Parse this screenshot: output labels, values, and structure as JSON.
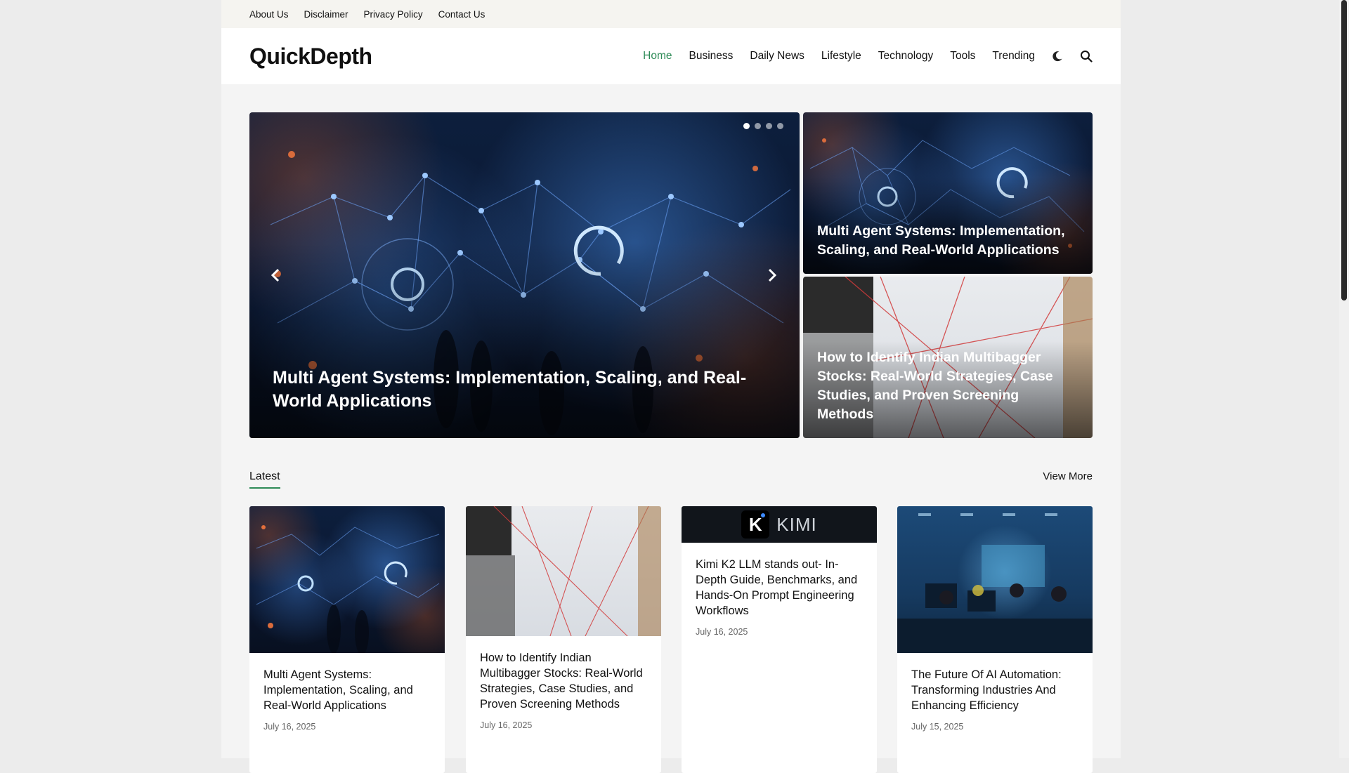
{
  "topbar": {
    "links": [
      "About Us",
      "Disclaimer",
      "Privacy Policy",
      "Contact Us"
    ]
  },
  "header": {
    "logo": "QuickDepth",
    "nav": [
      "Home",
      "Business",
      "Daily News",
      "Lifestyle",
      "Technology",
      "Tools",
      "Trending"
    ],
    "active_nav": "Home",
    "icons": [
      "moon-icon",
      "search-icon"
    ]
  },
  "hero": {
    "slide_title": "Multi Agent Systems: Implementation, Scaling, and Real-World Applications",
    "side_cards": [
      {
        "title": "Multi Agent Systems: Implementation, Scaling, and Real-World Applications"
      },
      {
        "title": "How to Identify Indian Multibagger Stocks: Real-World Strategies, Case Studies, and Proven Screening Methods"
      }
    ],
    "slide_count": 4,
    "active_slide": 1
  },
  "latest": {
    "title": "Latest",
    "view_more": "View More",
    "cards": [
      {
        "title": "Multi Agent Systems: Implementation, Scaling, and Real-World Applications",
        "date": "July 16, 2025"
      },
      {
        "title": "How to Identify Indian Multibagger Stocks: Real-World Strategies, Case Studies, and Proven Screening Methods",
        "date": "July 16, 2025"
      },
      {
        "title": "Kimi K2 LLM stands out- In-Depth Guide, Benchmarks, and Hands-On Prompt Engineering Workflows",
        "date": "July 16, 2025",
        "logo_letter": "K",
        "logo_word": "KIMI"
      },
      {
        "title": "The Future Of AI Automation: Transforming Industries And Enhancing Efficiency",
        "date": "July 15, 2025"
      }
    ]
  },
  "colors": {
    "accent": "#2e8b57",
    "page_bg": "#f4f4f4",
    "outer_bg": "#ececec"
  }
}
